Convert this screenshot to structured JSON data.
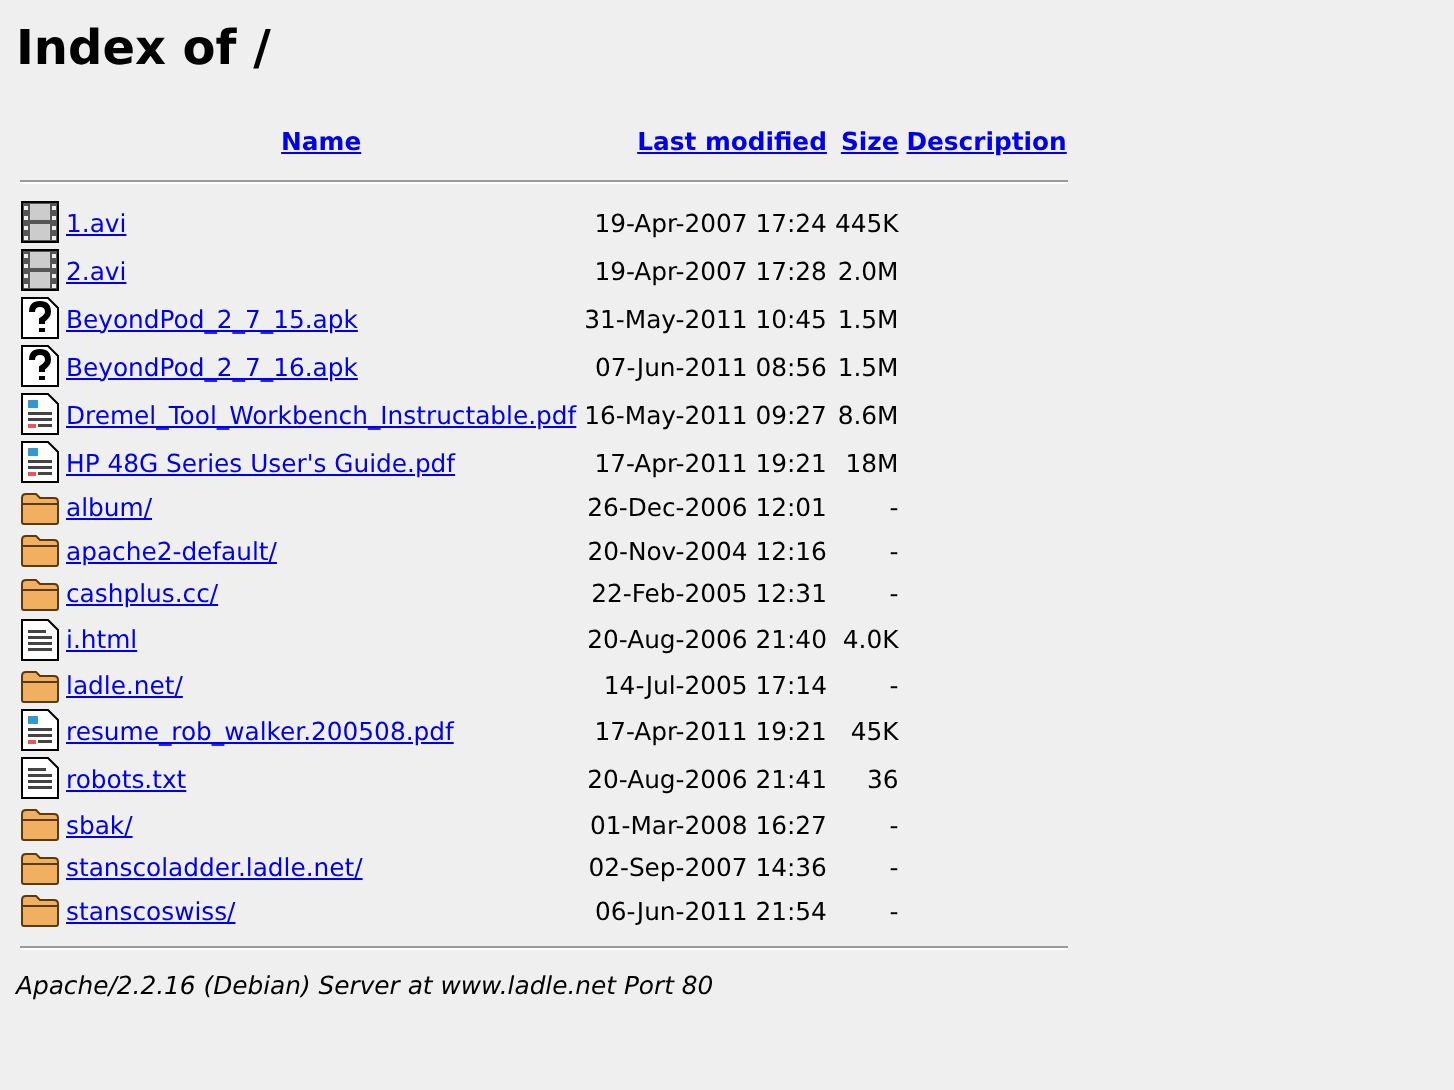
{
  "title": "Index of /",
  "columns": [
    "Name",
    "Last modified",
    "Size",
    "Description"
  ],
  "rows": [
    {
      "kind": "video",
      "name": "1.avi",
      "modified": "19-Apr-2007 17:24",
      "size": "445K"
    },
    {
      "kind": "video",
      "name": "2.avi",
      "modified": "19-Apr-2007 17:28",
      "size": "2.0M"
    },
    {
      "kind": "unknown",
      "name": "BeyondPod_2_7_15.apk",
      "modified": "31-May-2011 10:45",
      "size": "1.5M"
    },
    {
      "kind": "unknown",
      "name": "BeyondPod_2_7_16.apk",
      "modified": "07-Jun-2011 08:56",
      "size": "1.5M"
    },
    {
      "kind": "layout",
      "name": "Dremel_Tool_Workbench_Instructable.pdf",
      "modified": "16-May-2011 09:27",
      "size": "8.6M"
    },
    {
      "kind": "layout",
      "name": "HP 48G Series User's Guide.pdf",
      "modified": "17-Apr-2011 19:21",
      "size": "18M"
    },
    {
      "kind": "folder",
      "name": "album/",
      "modified": "26-Dec-2006 12:01",
      "size": "-"
    },
    {
      "kind": "folder",
      "name": "apache2-default/",
      "modified": "20-Nov-2004 12:16",
      "size": "-"
    },
    {
      "kind": "folder",
      "name": "cashplus.cc/",
      "modified": "22-Feb-2005 12:31",
      "size": "-"
    },
    {
      "kind": "text",
      "name": "i.html",
      "modified": "20-Aug-2006 21:40",
      "size": "4.0K"
    },
    {
      "kind": "folder",
      "name": "ladle.net/",
      "modified": "14-Jul-2005 17:14",
      "size": "-"
    },
    {
      "kind": "layout",
      "name": "resume_rob_walker.200508.pdf",
      "modified": "17-Apr-2011 19:21",
      "size": "45K"
    },
    {
      "kind": "text",
      "name": "robots.txt",
      "modified": "20-Aug-2006 21:41",
      "size": "36"
    },
    {
      "kind": "folder",
      "name": "sbak/",
      "modified": "01-Mar-2008 16:27",
      "size": "-"
    },
    {
      "kind": "folder",
      "name": "stanscoladder.ladle.net/",
      "modified": "02-Sep-2007 14:36",
      "size": "-"
    },
    {
      "kind": "folder",
      "name": "stanscoswiss/",
      "modified": "06-Jun-2011 21:54",
      "size": "-"
    }
  ],
  "footer": "Apache/2.2.16 (Debian) Server at www.ladle.net Port 80"
}
